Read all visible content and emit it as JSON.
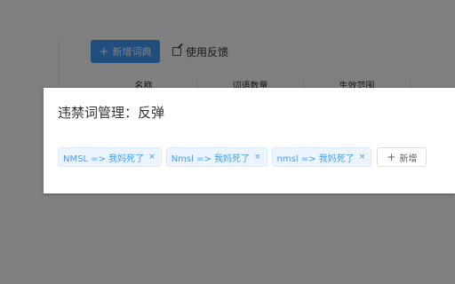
{
  "background": {
    "new_dict_button": "新增词典",
    "feedback_link": "使用反馈",
    "table_headers": [
      "名称",
      "词语数量",
      "生效范围"
    ]
  },
  "dialog": {
    "title": "违禁词管理：反弹",
    "tags": [
      {
        "label": "NMSL => 我妈死了",
        "close": "×"
      },
      {
        "label": "Nmsl => 我妈死了",
        "close": "×"
      },
      {
        "label": "nmsl => 我妈死了",
        "close": "×"
      }
    ],
    "add_button": "新增"
  },
  "icons": {
    "plus": "+",
    "edit": "edit-icon"
  },
  "colors": {
    "primary": "#409eff",
    "tag_bg": "#ecf5ff",
    "mask": "rgba(0,0,0,0.5)"
  }
}
